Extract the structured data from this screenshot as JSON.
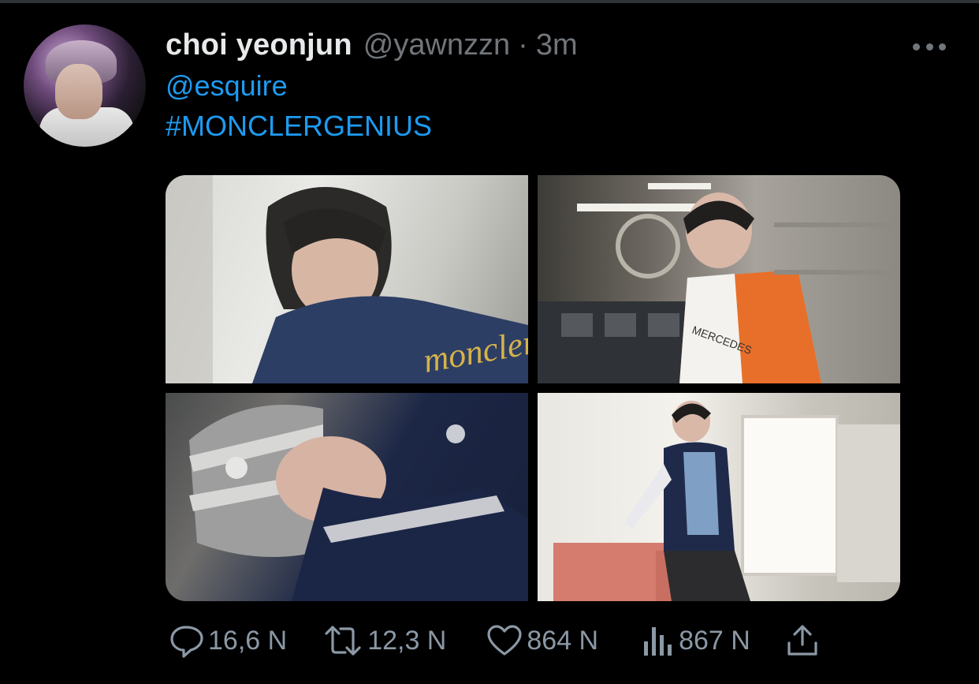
{
  "tweet": {
    "author_name": "choi yeonjun",
    "handle": "@yawnzzn",
    "separator": "·",
    "time": "3m",
    "mention": "@esquire",
    "hashtag": "#MONCLERGENIUS"
  },
  "photos": [
    {
      "overlay_text": "moncler"
    },
    {
      "overlay_text": "MERCEDES"
    },
    {},
    {}
  ],
  "actions": {
    "reply_count": "16,6 N",
    "retweet_count": "12,3 N",
    "like_count": "864 N",
    "views_count": "867 N"
  },
  "icons": {
    "more": "more-horizontal-icon",
    "reply": "reply-bubble-icon",
    "retweet": "retweet-arrows-icon",
    "like": "heart-icon",
    "views": "bar-chart-icon",
    "share": "share-upload-icon"
  },
  "colors": {
    "background": "#000000",
    "primary_text": "#e7e9ea",
    "secondary_text": "#71767b",
    "link": "#1d9bf0",
    "action": "#8b98a5"
  }
}
